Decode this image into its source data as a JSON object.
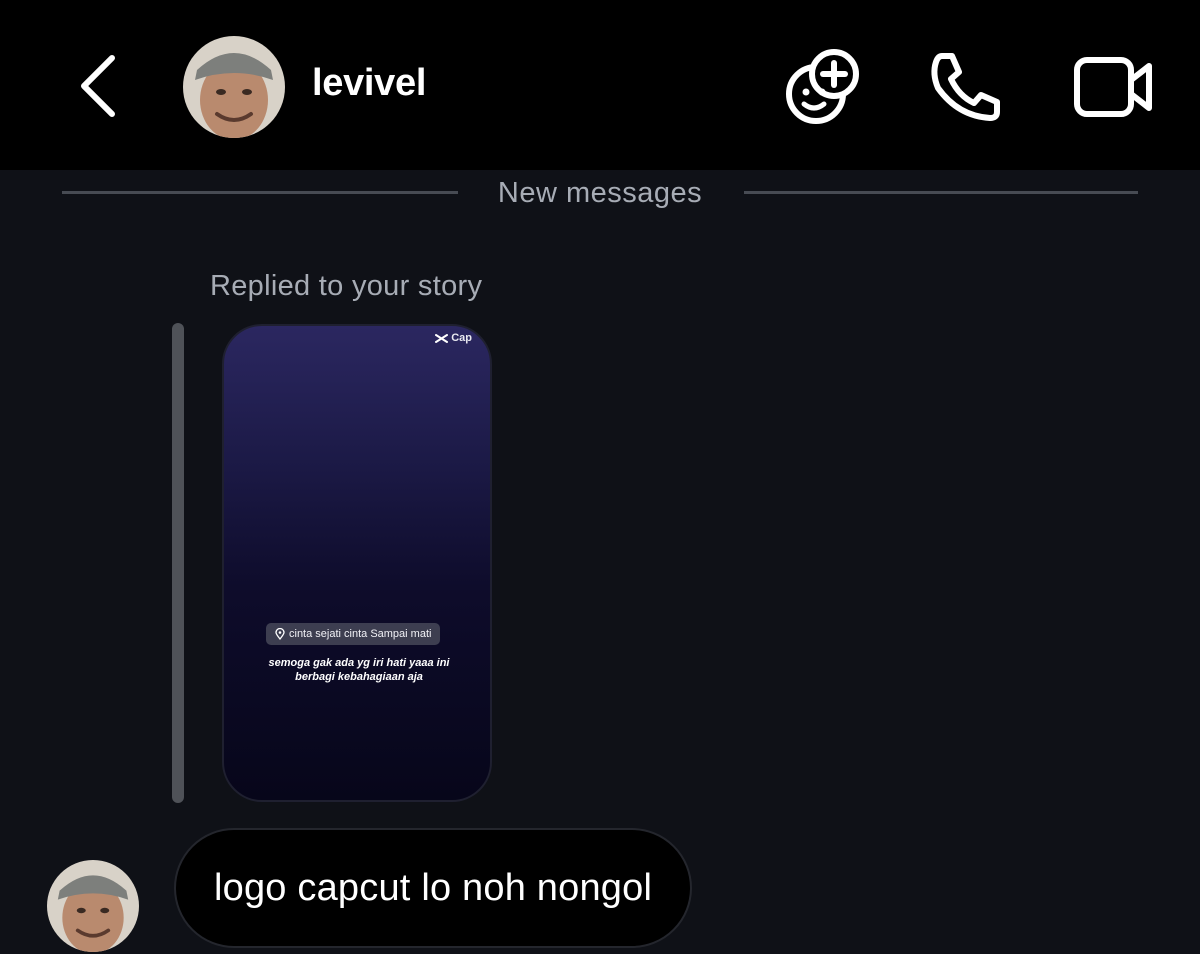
{
  "header": {
    "username": "levivel",
    "icons": {
      "back": "chevron-left-icon",
      "effects": "effects-add-icon",
      "call": "phone-icon",
      "video": "video-camera-icon"
    }
  },
  "divider": {
    "label": "New messages"
  },
  "story_reply": {
    "label": "Replied to your story",
    "story": {
      "brand": "Cap",
      "location": "cinta sejati cinta Sampai mati",
      "caption": "semoga gak ada yg iri hati yaaa ini berbagi kebahagiaan aja"
    }
  },
  "message": {
    "text": "logo capcut lo noh nongol"
  },
  "colors": {
    "background": "#0f1117",
    "header": "#000000",
    "muted_text": "#a7acb5",
    "bubble": "#000000"
  }
}
